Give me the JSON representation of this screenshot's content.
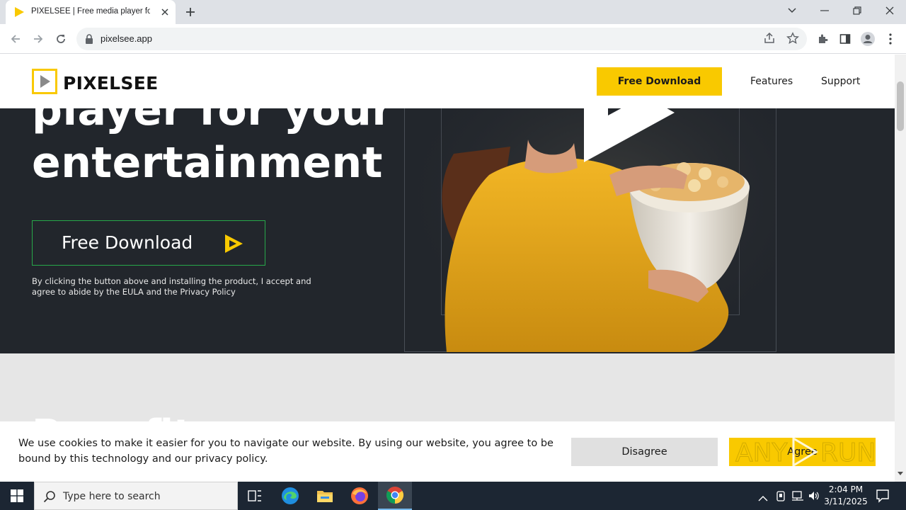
{
  "browser": {
    "tab_title": "PIXELSEE | Free media player for",
    "new_tab_label": "+",
    "url": "pixelsee.app"
  },
  "site": {
    "logo_text": "PIXELSEE",
    "nav": {
      "download_label": "Free Download",
      "features_label": "Features",
      "support_label": "Support"
    },
    "hero": {
      "headline_line1": "player for your",
      "headline_line2": "entertainment",
      "download_label": "Free Download",
      "note": "By clicking the button above and installing the product, I accept and agree to abide by the EULA and the Privacy Policy"
    },
    "section2_heading": "Benefits"
  },
  "cookie_banner": {
    "text": "We use cookies to make it easier for you to navigate our website. By using our website, you agree to be bound by this technology and our privacy policy.",
    "disagree_label": "Disagree",
    "agree_label": "Agree",
    "watermark": "ANY RUN"
  },
  "taskbar": {
    "search_placeholder": "Type here to search",
    "time": "2:04 PM",
    "date": "3/11/2025"
  },
  "colors": {
    "brand_yellow": "#f9c900",
    "hero_bg": "#22262c",
    "hero_button_border": "#27a84a"
  }
}
